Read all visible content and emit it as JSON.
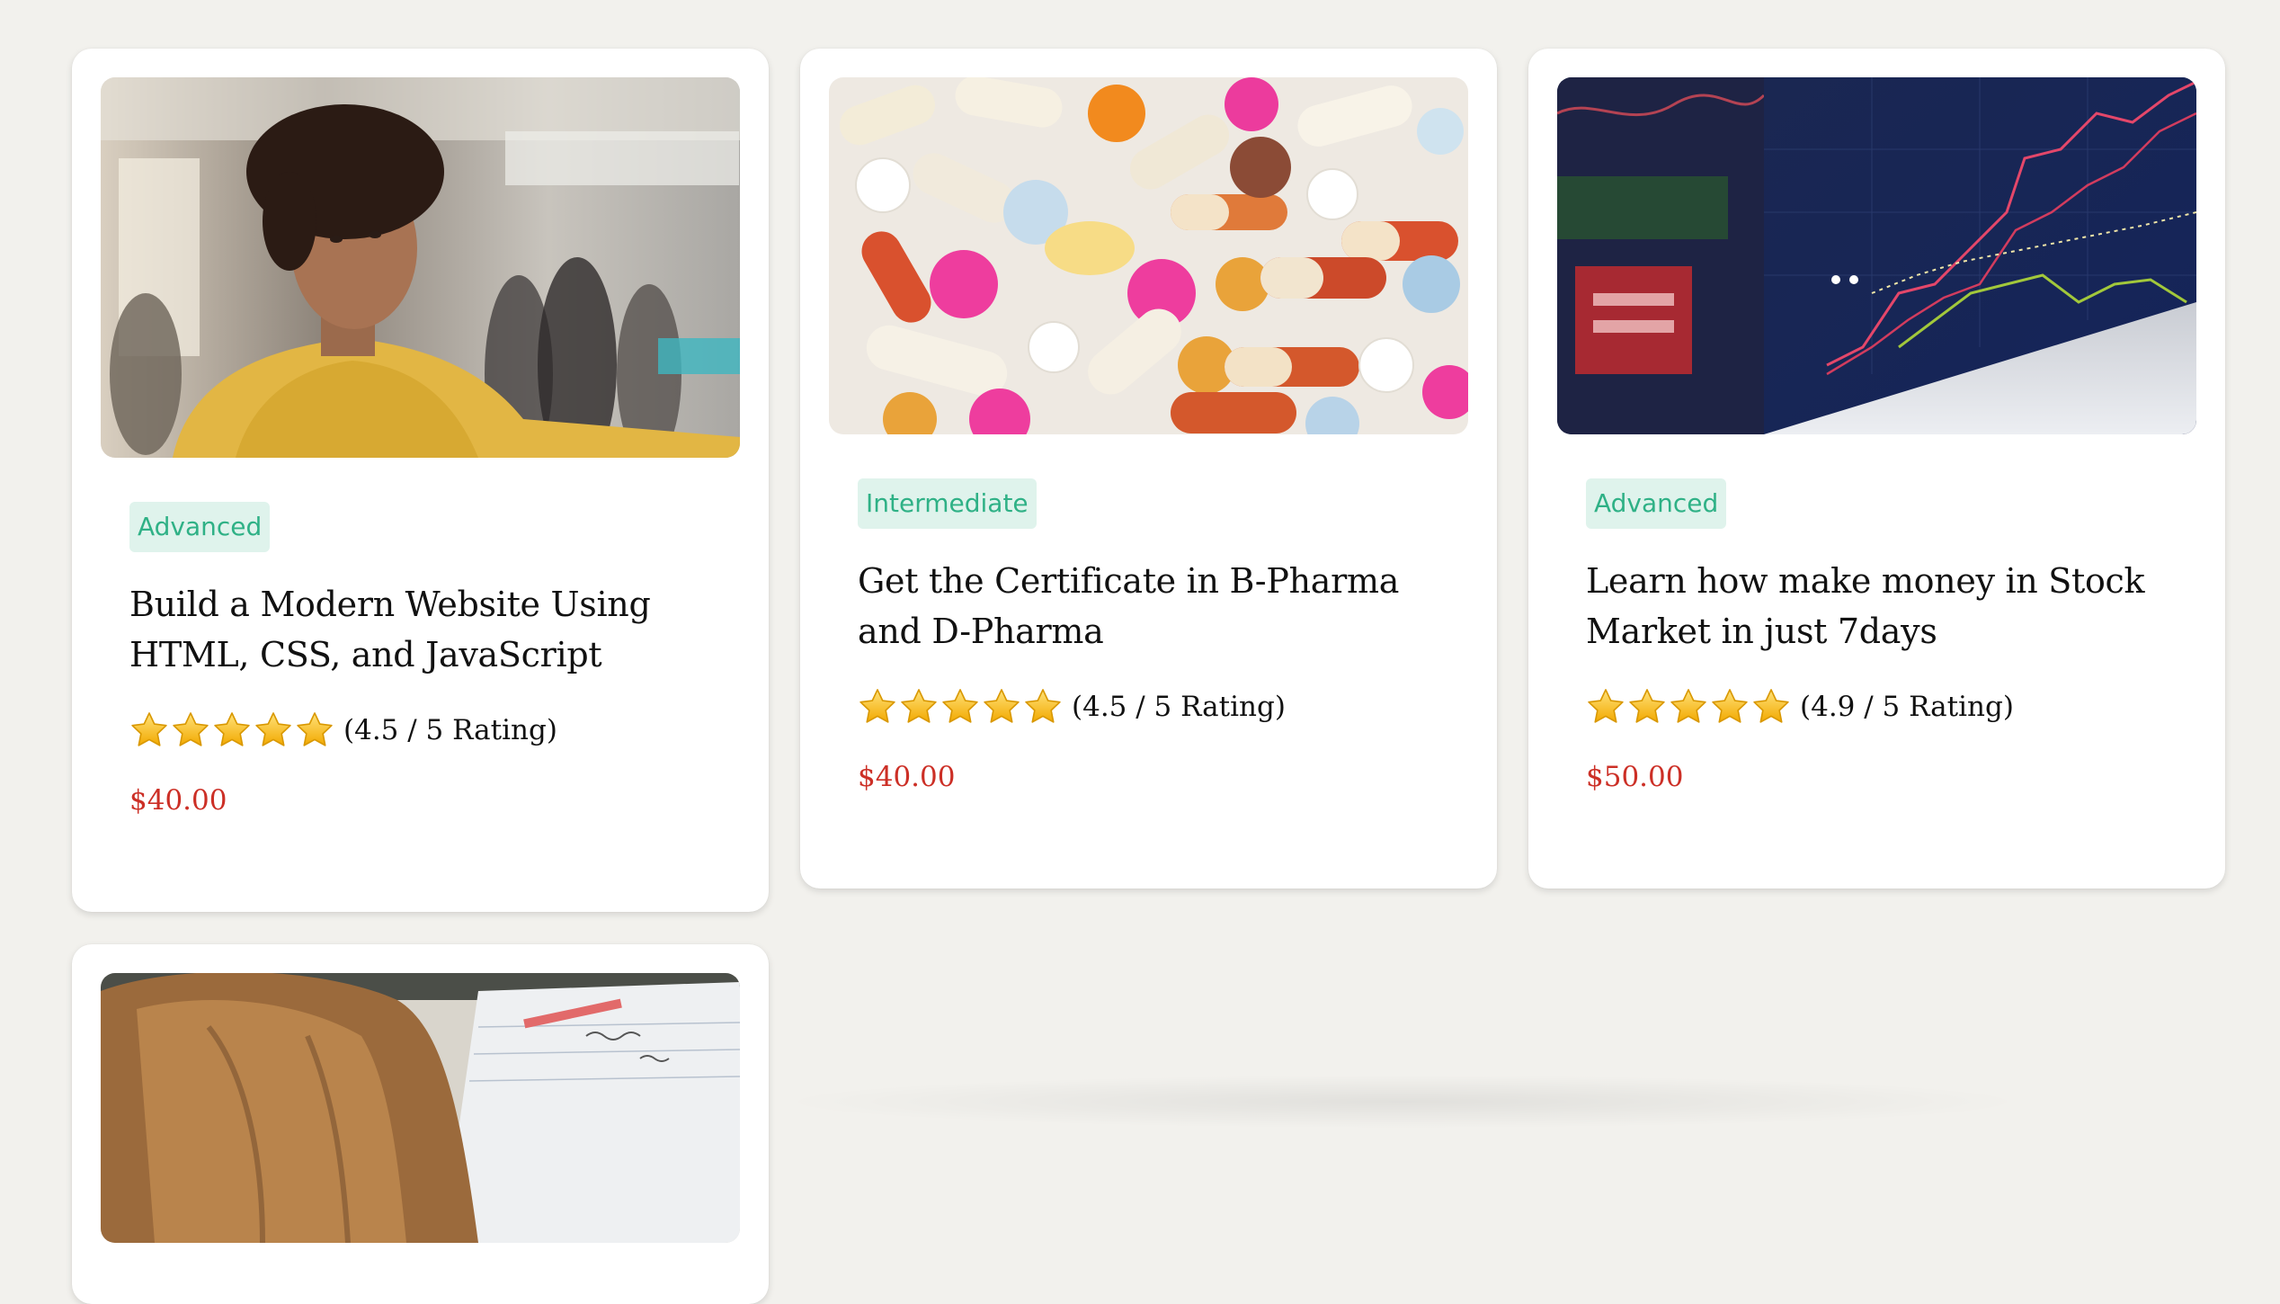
{
  "courses": [
    {
      "image": "developer-in-yellow-shirt-photo",
      "level": "Advanced",
      "title": "Build a Modern Website Using HTML, CSS, and JavaScript",
      "stars": 5,
      "rating_text": "(4.5 / 5 Rating)",
      "price": "$40.00"
    },
    {
      "image": "colorful-pills-photo",
      "level": "Intermediate",
      "title": "Get the Certificate in B-Pharma and D-Pharma",
      "stars": 5,
      "rating_text": "(4.5 / 5 Rating)",
      "price": "$40.00"
    },
    {
      "image": "stock-market-screen-photo",
      "level": "Advanced",
      "title": "Learn how make money in Stock Market in just 7days",
      "stars": 5,
      "rating_text": "(4.9 / 5 Rating)",
      "price": "$50.00"
    },
    {
      "image": "student-writing-notes-photo"
    }
  ],
  "colors": {
    "page_background": "#f2f1ed",
    "badge_background": "#dff3ec",
    "badge_text": "#2fb186",
    "price": "#cc2f26",
    "star": "#f7c21b"
  }
}
